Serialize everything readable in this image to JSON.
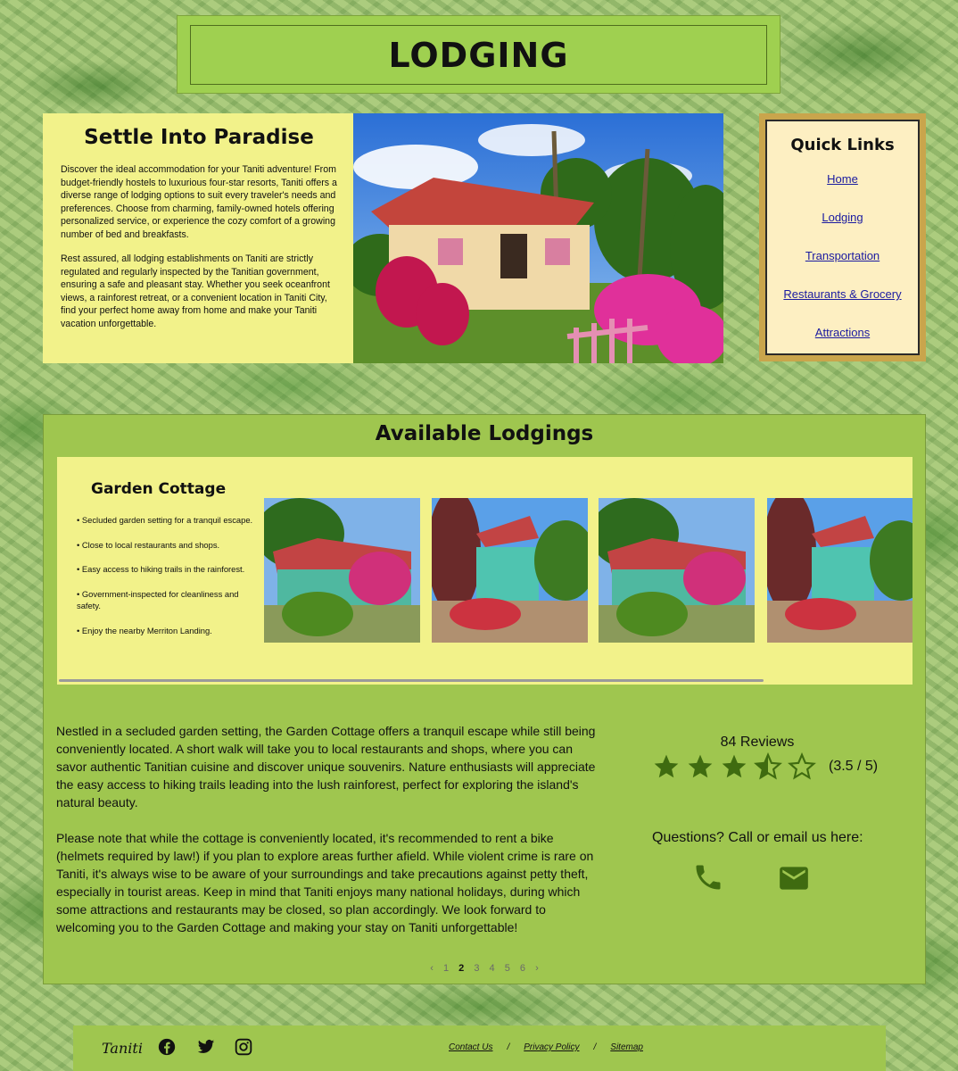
{
  "page": {
    "title": "LODGING"
  },
  "intro": {
    "heading": "Settle Into Paradise",
    "p1": "Discover the ideal accommodation for your Taniti adventure! From budget-friendly hostels to luxurious four-star resorts, Taniti offers a diverse range of lodging options to suit every traveler's needs and preferences. Choose from charming, family-owned hotels offering personalized service, or experience the cozy comfort of a growing number of bed and breakfasts.",
    "p2": "Rest assured, all lodging establishments on Taniti are strictly regulated and regularly inspected by the Tanitian government, ensuring a safe and pleasant stay. Whether you seek oceanfront views, a rainforest retreat, or a convenient location in Taniti City, find your perfect home away from home and make your Taniti vacation unforgettable."
  },
  "quick_links": {
    "heading": "Quick Links",
    "items": [
      "Home",
      "Lodging",
      "Transportation",
      "Restaurants & Grocery",
      "Attractions"
    ]
  },
  "available": {
    "heading": "Available Lodgings",
    "card": {
      "name": "Garden Cottage",
      "bullets": [
        "• Secluded garden setting for a tranquil escape.",
        "• Close to local restaurants and shops.",
        "• Easy access to hiking trails in the rainforest.",
        "• Government-inspected for cleanliness and safety.",
        "• Enjoy the nearby Merriton Landing."
      ]
    },
    "description": [
      "Nestled in a secluded garden setting, the Garden Cottage offers a tranquil escape while still being conveniently located. A short walk will take you to local restaurants and shops, where you can savor authentic Tanitian cuisine and discover unique souvenirs. Nature enthusiasts will appreciate the easy access to hiking trails leading into the lush rainforest, perfect for exploring the island's natural beauty.",
      "Please note that while the cottage is conveniently located, it's recommended to rent a bike (helmets required by law!) if you plan to explore areas further afield. While violent crime is rare on Taniti, it's always wise to be aware of your surroundings and take precautions against petty theft, especially in tourist areas. Keep in mind that Taniti enjoys many national holidays, during which some attractions and restaurants may be closed, so plan accordingly. We look forward to welcoming you to the Garden Cottage and making your stay on Taniti unforgettable!"
    ],
    "reviews": {
      "count_text": "84 Reviews",
      "rating": 3.5,
      "max": 5,
      "rating_text": "(3.5 / 5)"
    },
    "contact_text": "Questions? Call or email us here:",
    "pager": {
      "prev": "‹",
      "next": "›",
      "pages": [
        "1",
        "2",
        "3",
        "4",
        "5",
        "6"
      ],
      "current": "2"
    }
  },
  "footer": {
    "brand": "Taniti",
    "links": [
      "Contact Us",
      "Privacy Policy",
      "Sitemap"
    ],
    "separator": "/",
    "icons": [
      "facebook-icon",
      "twitter-icon",
      "instagram-icon"
    ]
  },
  "colors": {
    "panel_green": "#9fc64f",
    "panel_yellow": "#f2f28a",
    "quicklinks_bg": "#fdefc2",
    "quicklinks_frame": "#c9a54c",
    "icon_green": "#3f6b10"
  }
}
